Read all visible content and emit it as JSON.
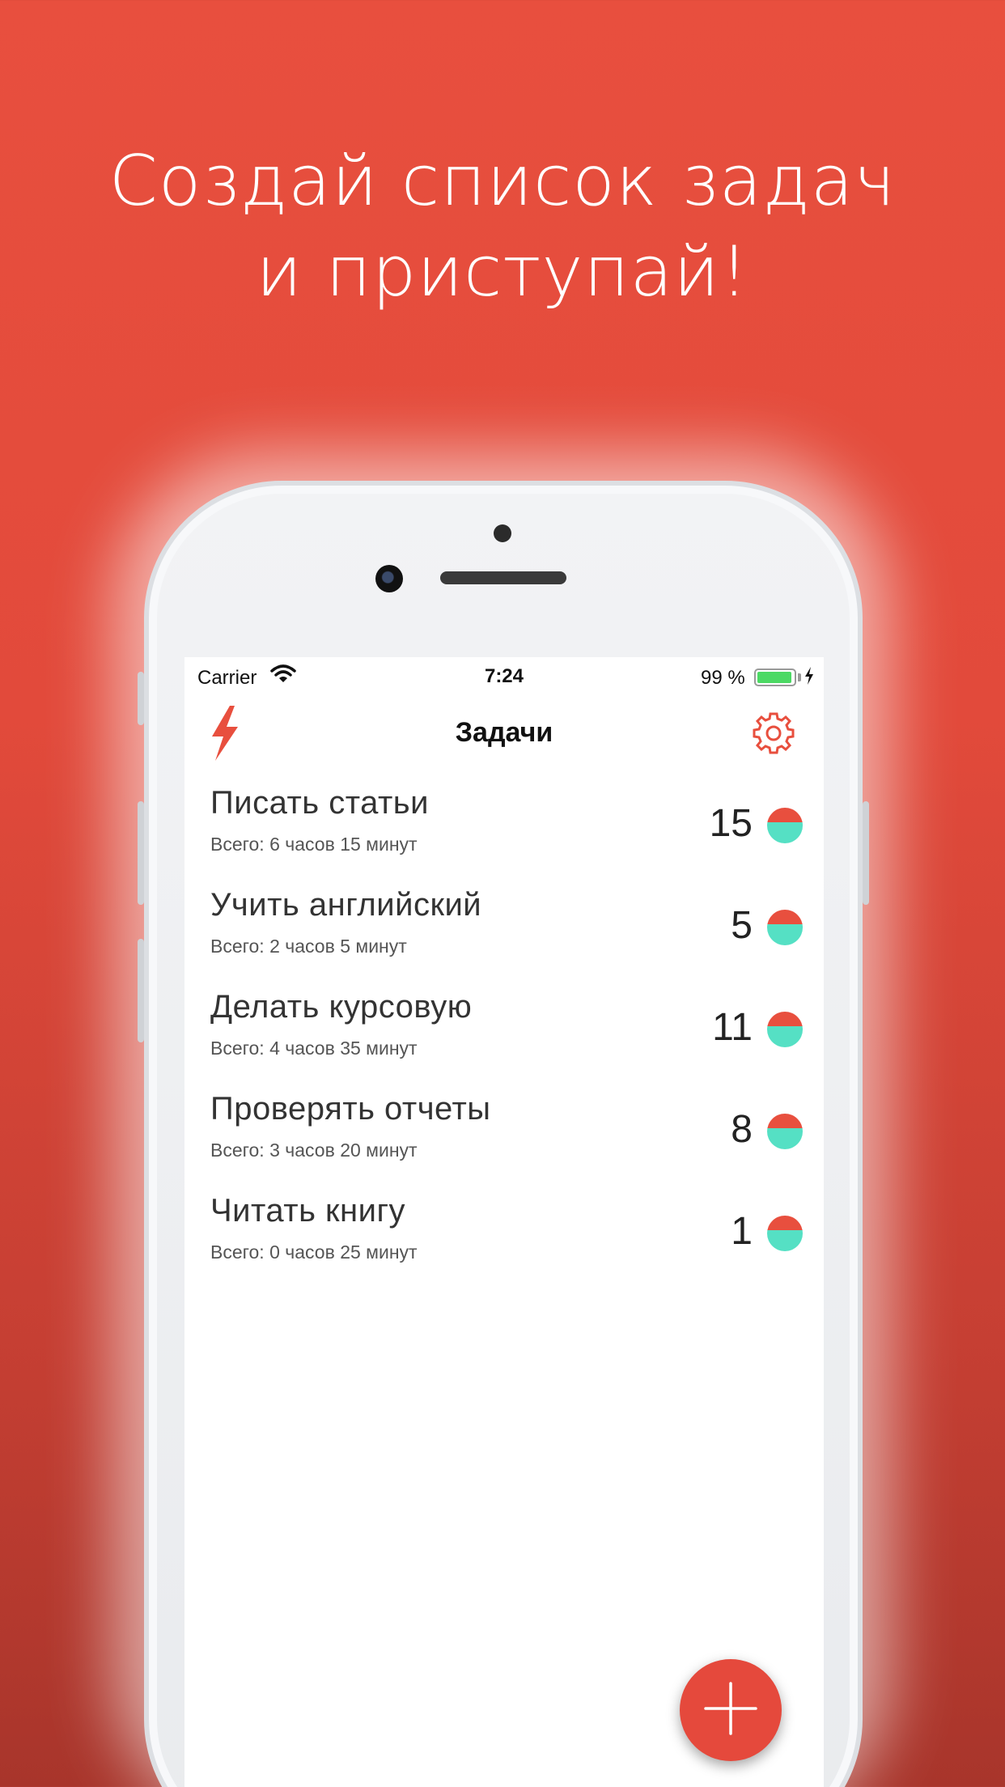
{
  "promo": {
    "line1": "Создай список задач",
    "line2": "и приступай!"
  },
  "status_bar": {
    "carrier": "Carrier",
    "time": "7:24",
    "battery": "99 %"
  },
  "navbar": {
    "title": "Задачи",
    "logo_icon": "lightning-bolt-icon",
    "settings_icon": "gear-icon"
  },
  "tasks": [
    {
      "name": "Писать статьи",
      "total": "Всего: 6 часов 15 минут",
      "count": "15"
    },
    {
      "name": "Учить английский",
      "total": "Всего: 2 часов 5 минут",
      "count": "5"
    },
    {
      "name": "Делать курсовую",
      "total": "Всего: 4 часов 35 минут",
      "count": "11"
    },
    {
      "name": "Проверять отчеты",
      "total": "Всего: 3 часов 20 минут",
      "count": "8"
    },
    {
      "name": "Читать книгу",
      "total": "Всего: 0 часов 25 минут",
      "count": "1"
    }
  ],
  "fab": {
    "icon": "plus-icon"
  },
  "colors": {
    "accent": "#e84f3e",
    "indicator_top": "#e84f3e",
    "indicator_bottom": "#55e0c4",
    "battery": "#4cd964"
  }
}
